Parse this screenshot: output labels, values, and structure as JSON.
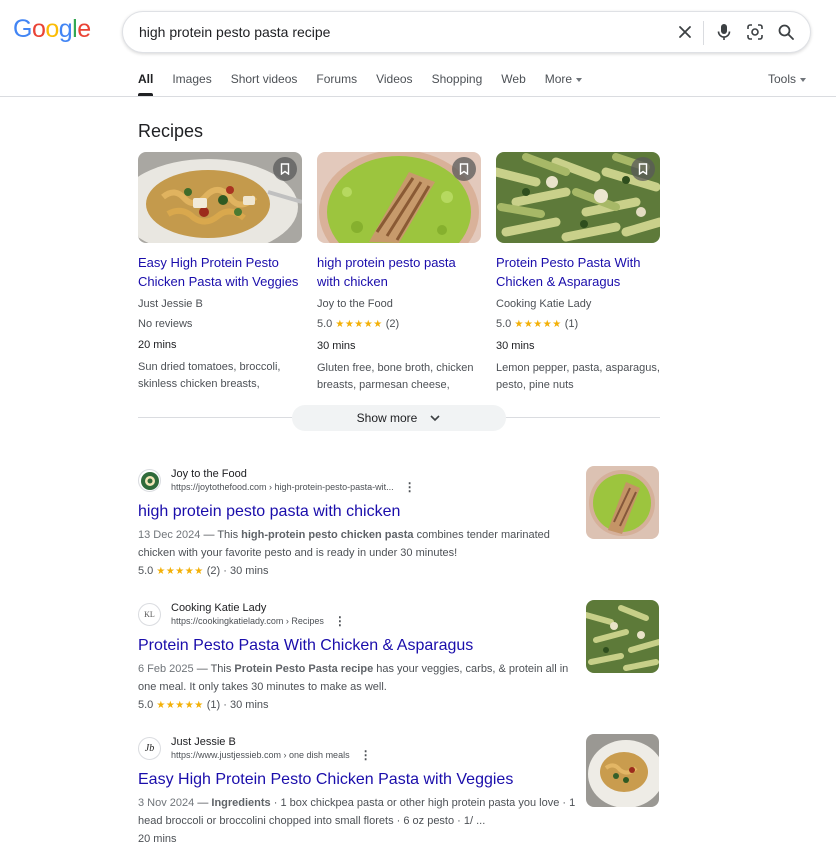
{
  "logo": {
    "text": "Google"
  },
  "search": {
    "query": "high protein pesto pasta recipe"
  },
  "tabs": [
    {
      "label": "All",
      "active": true
    },
    {
      "label": "Images"
    },
    {
      "label": "Short videos"
    },
    {
      "label": "Forums"
    },
    {
      "label": "Videos"
    },
    {
      "label": "Shopping"
    },
    {
      "label": "Web"
    },
    {
      "label": "More"
    }
  ],
  "tools_label": "Tools",
  "recipes": {
    "title": "Recipes",
    "cards": [
      {
        "title": "Easy High Protein Pesto Chicken Pasta with Veggies",
        "source": "Just Jessie B",
        "rating_text": "No reviews",
        "rating": null,
        "count": "",
        "time": "20 mins",
        "ingredients": "Sun dried tomatoes, broccoli, skinless chicken breasts,"
      },
      {
        "title": "high protein pesto pasta with chicken",
        "source": "Joy to the Food",
        "rating_text": "",
        "rating": "5.0",
        "count": "(2)",
        "time": "30 mins",
        "ingredients": "Gluten free, bone broth, chicken breasts, parmesan cheese,"
      },
      {
        "title": "Protein Pesto Pasta With Chicken & Asparagus",
        "source": "Cooking Katie Lady",
        "rating_text": "",
        "rating": "5.0",
        "count": "(1)",
        "time": "30 mins",
        "ingredients": "Lemon pepper, pasta, asparagus, pesto, pine nuts"
      }
    ],
    "show_more": "Show more"
  },
  "results": [
    {
      "site": "Joy to the Food",
      "url": "https://joytothefood.com › high-protein-pesto-pasta-wit...",
      "title": "high protein pesto pasta with chicken",
      "date": "13 Dec 2024",
      "snip_a": "This ",
      "snip_b": "high-protein pesto chicken pasta",
      "snip_c": " combines tender marinated chicken with your favorite pesto and is ready in under 30 minutes!",
      "rating": "5.0",
      "count": "(2)",
      "time": "30 mins"
    },
    {
      "site": "Cooking Katie Lady",
      "url": "https://cookingkatielady.com › Recipes",
      "title": "Protein Pesto Pasta With Chicken & Asparagus",
      "date": "6 Feb 2025",
      "snip_a": "This ",
      "snip_b": "Protein Pesto Pasta recipe",
      "snip_c": " has your veggies, carbs, & protein all in one meal. It only takes 30 minutes to make as well.",
      "rating": "5.0",
      "count": "(1)",
      "time": "30 mins"
    },
    {
      "site": "Just Jessie B",
      "url": "https://www.justjessieb.com › one dish meals",
      "title": "Easy High Protein Pesto Chicken Pasta with Veggies",
      "date": "3 Nov 2024",
      "snip_a": "",
      "snip_b": "Ingredients",
      "snip_c": " · 1 box chickpea pasta or other high protein pasta you love · 1 head broccoli or broccolini chopped into small florets · 6 oz pesto · 1/ ...",
      "rating": "",
      "count": "",
      "time": "20 mins"
    }
  ],
  "favicon_text": {
    "katie": "KL",
    "jessie": "Jb"
  },
  "colors": {
    "link": "#1a0dab",
    "star": "#f3b007",
    "pesto_green": "#9cc53e"
  },
  "stars_glyph": "★★★★★",
  "sep": " · ",
  "dash": " — "
}
